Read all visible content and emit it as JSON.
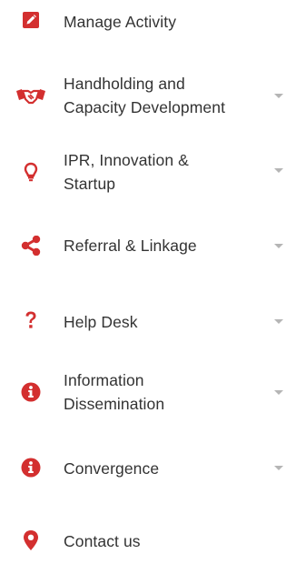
{
  "menu": {
    "items": [
      {
        "label": "Manage Activity",
        "icon": "edit-icon"
      },
      {
        "label_line1": "Handholding and",
        "label_line2": "Capacity Development",
        "icon": "handshake-icon"
      },
      {
        "label_line1": "IPR, Innovation &",
        "label_line2": "Startup",
        "icon": "lightbulb-icon"
      },
      {
        "label": "Referral & Linkage",
        "icon": "share-icon"
      },
      {
        "label": "Help Desk",
        "icon": "question-icon"
      },
      {
        "label_line1": "Information",
        "label_line2": "Dissemination",
        "icon": "info-icon"
      },
      {
        "label": "Convergence",
        "icon": "info-icon"
      },
      {
        "label": "Contact us",
        "icon": "location-pin-icon"
      }
    ]
  },
  "colors": {
    "accent": "#d32f2f",
    "text": "#333333",
    "caret": "#b5b5b5"
  }
}
